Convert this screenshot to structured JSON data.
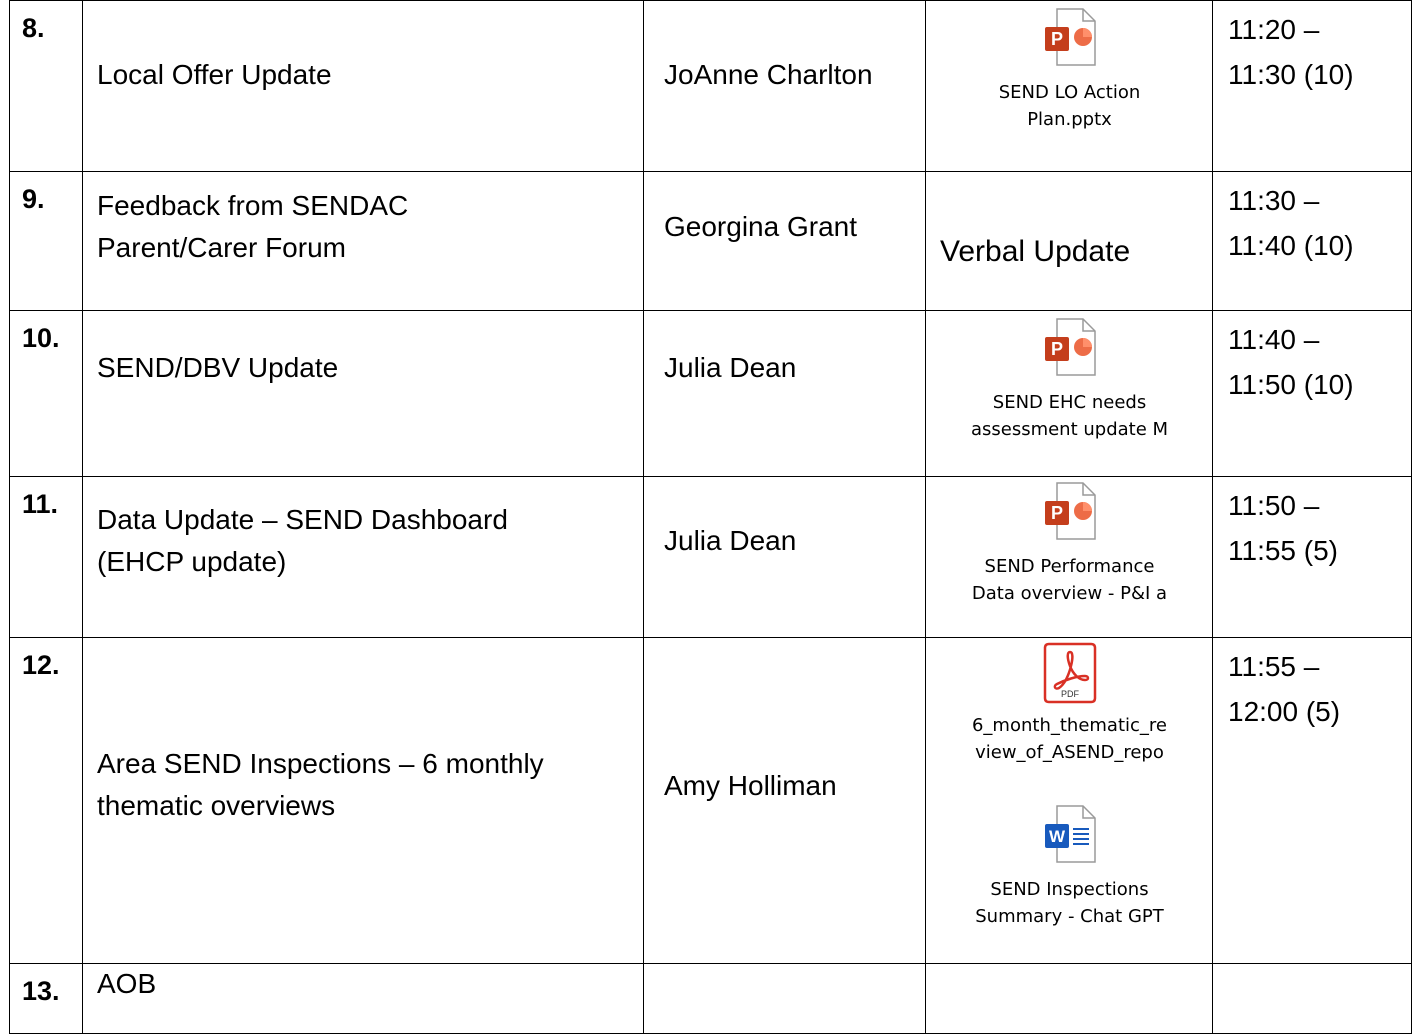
{
  "rows": [
    {
      "num": "8.",
      "item": [
        "Local Offer Update"
      ],
      "lead": "JoAnne Charlton",
      "attachments": [
        {
          "icon": "powerpoint-icon",
          "caption": [
            "SEND LO Action",
            "Plan.pptx"
          ]
        }
      ],
      "time": [
        "11:20 –",
        "11:30 (10)"
      ]
    },
    {
      "num": "9.",
      "item": [
        "Feedback from SENDAC",
        "Parent/Carer Forum"
      ],
      "lead": "Georgina Grant",
      "verbal": "Verbal Update",
      "time": [
        "11:30 –",
        "11:40 (10)"
      ]
    },
    {
      "num": "10.",
      "item": [
        "SEND/DBV Update"
      ],
      "lead": "Julia Dean",
      "attachments": [
        {
          "icon": "powerpoint-icon",
          "caption": [
            "SEND EHC needs",
            "assessment update M"
          ]
        }
      ],
      "time": [
        "11:40 –",
        "11:50 (10)"
      ]
    },
    {
      "num": "11.",
      "item": [
        "Data Update – SEND Dashboard",
        "(EHCP update)"
      ],
      "lead": "Julia Dean",
      "attachments": [
        {
          "icon": "powerpoint-icon",
          "caption": [
            "SEND Performance",
            "Data overview - P&I a"
          ]
        }
      ],
      "time": [
        "11:50 –",
        "11:55 (5)"
      ]
    },
    {
      "num": "12.",
      "item": [
        "Area SEND Inspections – 6 monthly",
        "thematic overviews"
      ],
      "lead": "Amy Holliman",
      "attachments": [
        {
          "icon": "pdf-icon",
          "caption": [
            "6_month_thematic_re",
            "view_of_ASEND_repo"
          ]
        },
        {
          "icon": "word-icon",
          "caption": [
            "SEND Inspections",
            "Summary - Chat GPT"
          ]
        }
      ],
      "time": [
        "11:55 –",
        "12:00 (5)"
      ]
    },
    {
      "num": "13.",
      "item": [
        "AOB"
      ],
      "lead": "",
      "time": [
        "",
        ""
      ]
    }
  ],
  "icons": {
    "powerpoint_badge": "P",
    "word_badge": "W",
    "pdf_badge": "PDF"
  },
  "colors": {
    "powerpoint": "#C43E1C",
    "word": "#185ABD",
    "pdf": "#D93025"
  }
}
